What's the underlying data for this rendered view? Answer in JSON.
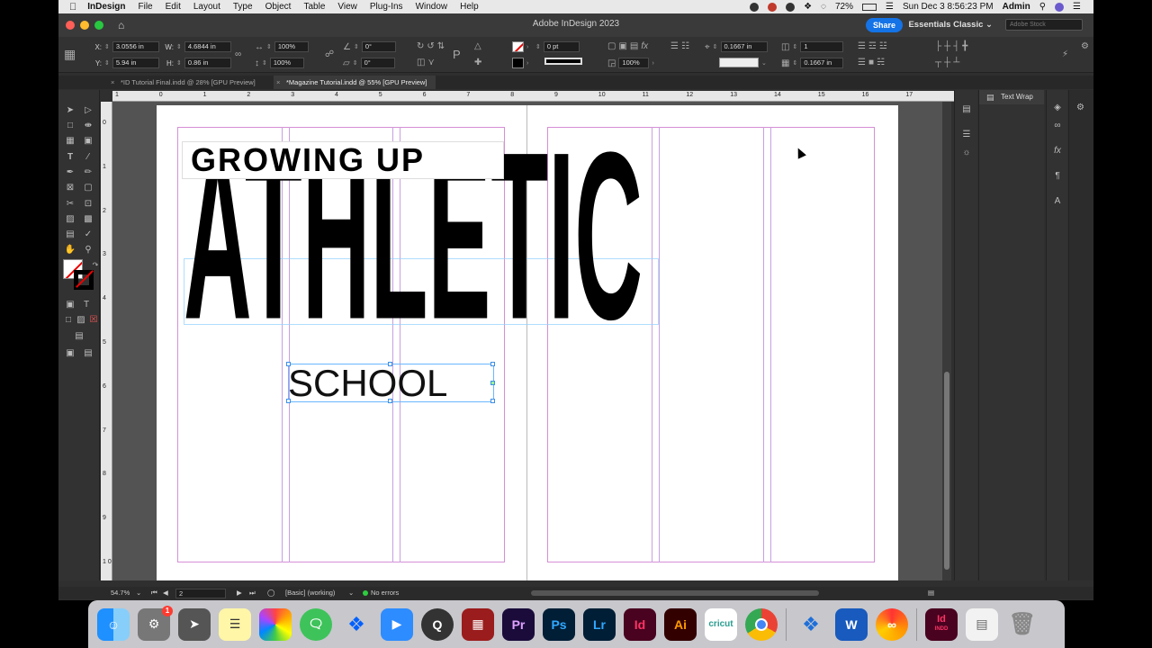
{
  "menubar": {
    "app_name": "InDesign",
    "items": [
      "File",
      "Edit",
      "Layout",
      "Type",
      "Object",
      "Table",
      "View",
      "Plug-Ins",
      "Window",
      "Help"
    ],
    "battery": "72%",
    "clock": "Sun Dec 3  8:56:23 PM",
    "user": "Admin"
  },
  "window": {
    "title": "Adobe InDesign 2023",
    "share_label": "Share",
    "workspace": "Essentials Classic",
    "stock_placeholder": "Adobe Stock"
  },
  "control": {
    "x_label": "X:",
    "x_value": "3.0556 in",
    "y_label": "Y:",
    "y_value": "5.94 in",
    "w_label": "W:",
    "w_value": "4.6844 in",
    "h_label": "H:",
    "h_value": "0.86 in",
    "scale_x": "100%",
    "scale_y": "100%",
    "angle": "0°",
    "shear": "0°",
    "stroke_weight": "0 pt",
    "opacity": "100%",
    "gutter": "0.1667 in",
    "columns": "1",
    "inset": "0.1667 in"
  },
  "tabs": [
    {
      "label": "*ID Tutorial Final.indd @ 28% [GPU Preview]"
    },
    {
      "label": "*Magazine Tutorial.indd @ 55% [GPU Preview]"
    }
  ],
  "ruler": {
    "h_ticks": [
      "1",
      "0",
      "1",
      "2",
      "3",
      "4",
      "5",
      "6",
      "7",
      "8",
      "9",
      "10",
      "11",
      "12",
      "13",
      "14",
      "15",
      "16",
      "17"
    ],
    "v_ticks": [
      "0",
      "1",
      "2",
      "3",
      "4",
      "5",
      "6",
      "7",
      "8",
      "9",
      "1 0"
    ]
  },
  "document": {
    "headline": "ATHLETIC",
    "kicker": "GROWING UP",
    "subhead": "SCHOOL"
  },
  "panels": {
    "text_wrap": "Text Wrap"
  },
  "status": {
    "zoom": "54.7%",
    "page": "2",
    "style": "[Basic] (working)",
    "preflight": "No errors"
  },
  "dock": {
    "apps": [
      "Finder",
      "System Settings",
      "Launchpad",
      "Notes",
      "Photos",
      "Messages",
      "Dropbox",
      "Zoom",
      "QuickTime",
      "Photo Booth",
      "Pr",
      "Ps",
      "Lr",
      "Id",
      "Ai",
      "cricut",
      "Chrome",
      "Bluetooth",
      "W",
      "Creative Cloud",
      "Id INDD",
      "Preview",
      "Trash"
    ],
    "settings_badge": "1"
  },
  "colors": {
    "accent": "#1473e6",
    "margin_guide": "#d68fd6",
    "column_guide": "#c8a0e0",
    "frame_edge": "#8fd0ff"
  }
}
